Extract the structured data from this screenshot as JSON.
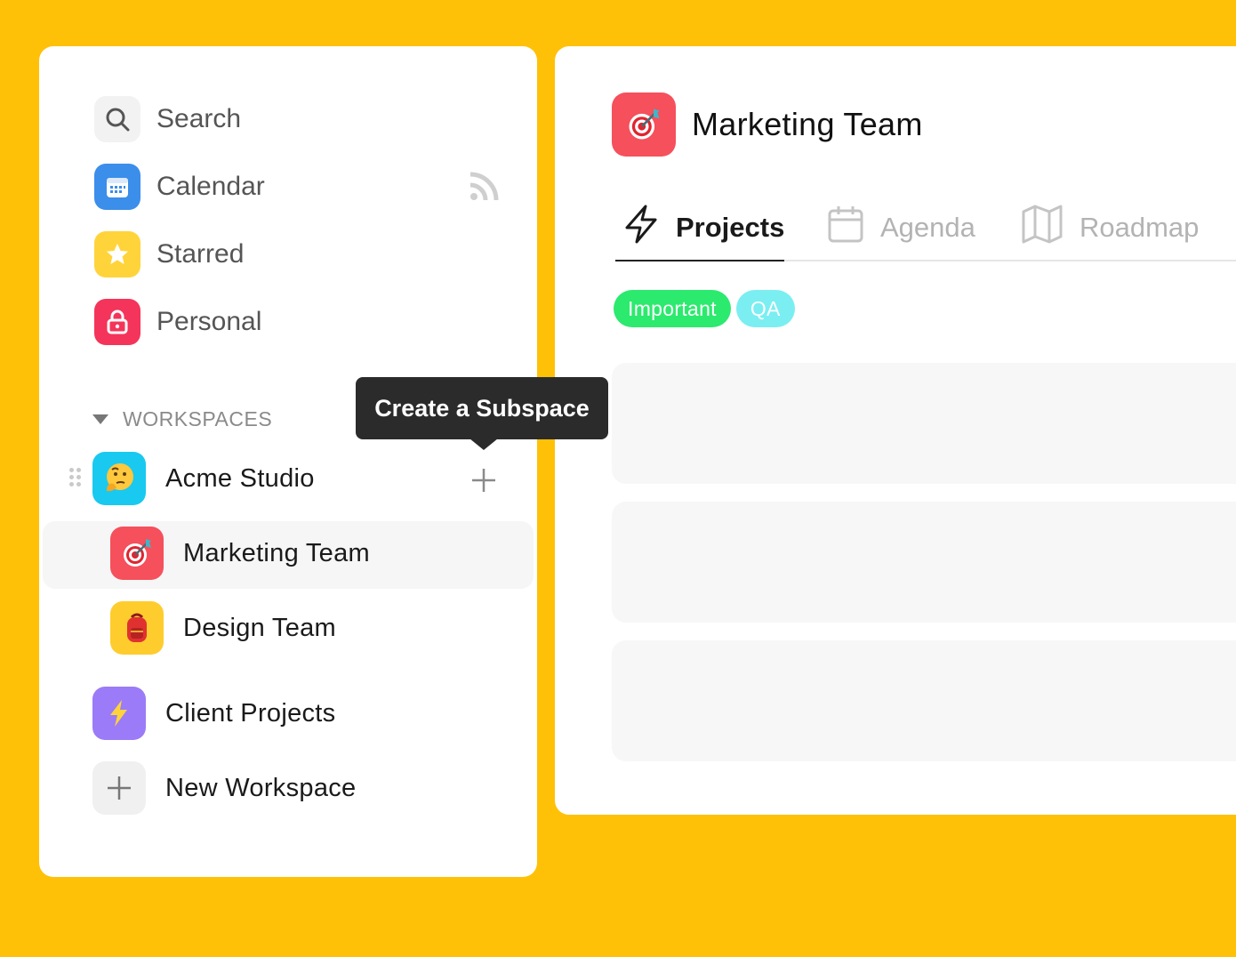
{
  "colors": {
    "background": "#FFC107",
    "calendar": "#3B8EEA",
    "starred": "#FFD43B",
    "personal": "#F4345A",
    "marketing": "#F5505C",
    "design": "#FFCC2E",
    "acme": "#19C9F0",
    "client": "#9B7BF7",
    "tag_important": "#2BEA6E",
    "tag_qa": "#7BEEF2"
  },
  "sidebar": {
    "nav": [
      {
        "label": "Search",
        "icon": "search-icon"
      },
      {
        "label": "Calendar",
        "icon": "calendar-icon",
        "extra_icon": "rss-icon"
      },
      {
        "label": "Starred",
        "icon": "star-icon"
      },
      {
        "label": "Personal",
        "icon": "lock-icon"
      }
    ],
    "workspaces_title": "WORKSPACES",
    "workspaces": [
      {
        "label": "Acme Studio",
        "icon": "thinking-face-icon"
      },
      {
        "label": "Marketing Team",
        "icon": "dart-target-icon",
        "selected": true
      },
      {
        "label": "Design Team",
        "icon": "backpack-icon"
      },
      {
        "label": "Client Projects",
        "icon": "lightning-icon"
      },
      {
        "label": "New Workspace",
        "icon": "plus-icon"
      }
    ]
  },
  "tooltip": {
    "text": "Create a Subspace"
  },
  "main": {
    "title": "Marketing Team",
    "title_icon": "dart-target-icon",
    "tabs": [
      {
        "label": "Projects",
        "icon": "lightning-outline-icon",
        "active": true
      },
      {
        "label": "Agenda",
        "icon": "calendar-outline-icon",
        "active": false
      },
      {
        "label": "Roadmap",
        "icon": "map-icon",
        "active": false
      }
    ],
    "tags": [
      {
        "label": "Important"
      },
      {
        "label": "QA"
      }
    ]
  }
}
